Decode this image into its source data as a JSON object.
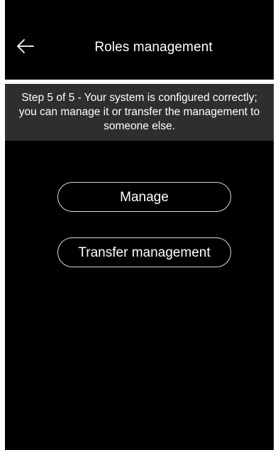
{
  "header": {
    "back_icon": "arrow-left-icon",
    "title": "Roles management"
  },
  "banner": {
    "text": "Step 5 of 5 -  Your system is configured correctly; you can manage it or transfer the management to someone else."
  },
  "actions": {
    "manage_label": "Manage",
    "transfer_label": "Transfer management"
  },
  "colors": {
    "background": "#000000",
    "banner_background": "#2e2e2e",
    "divider": "#ffffff",
    "text": "#ffffff",
    "button_border": "#d8d8d8"
  }
}
